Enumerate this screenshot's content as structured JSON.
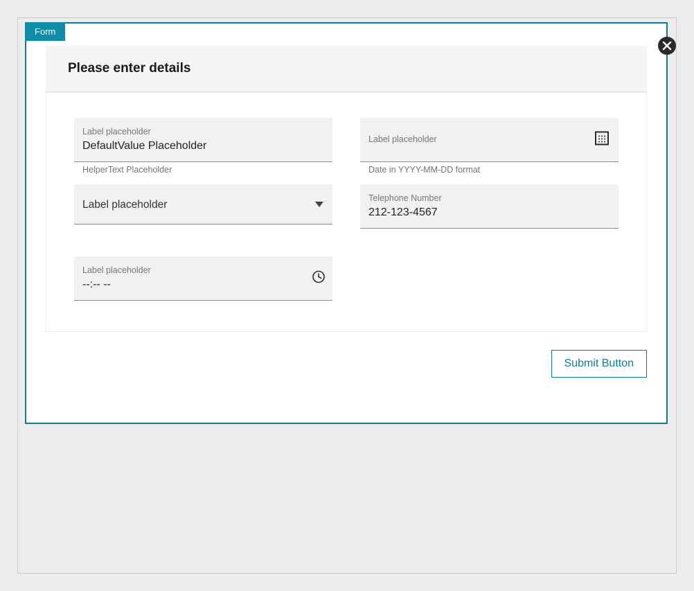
{
  "tab_label": "Form",
  "header": {
    "title": "Please enter details"
  },
  "fields": {
    "text": {
      "label": "Label placeholder",
      "value": "DefaultValue Placeholder",
      "helper": "HelperText Placeholder"
    },
    "date": {
      "label": "Label placeholder",
      "value": "",
      "helper": "Date in YYYY-MM-DD format"
    },
    "select": {
      "label": "Label placeholder"
    },
    "tel": {
      "label": "Telephone Number",
      "value": "212-123-4567"
    },
    "time": {
      "label": "Label placeholder",
      "value": "--:-- --"
    }
  },
  "submit_label": "Submit Button"
}
